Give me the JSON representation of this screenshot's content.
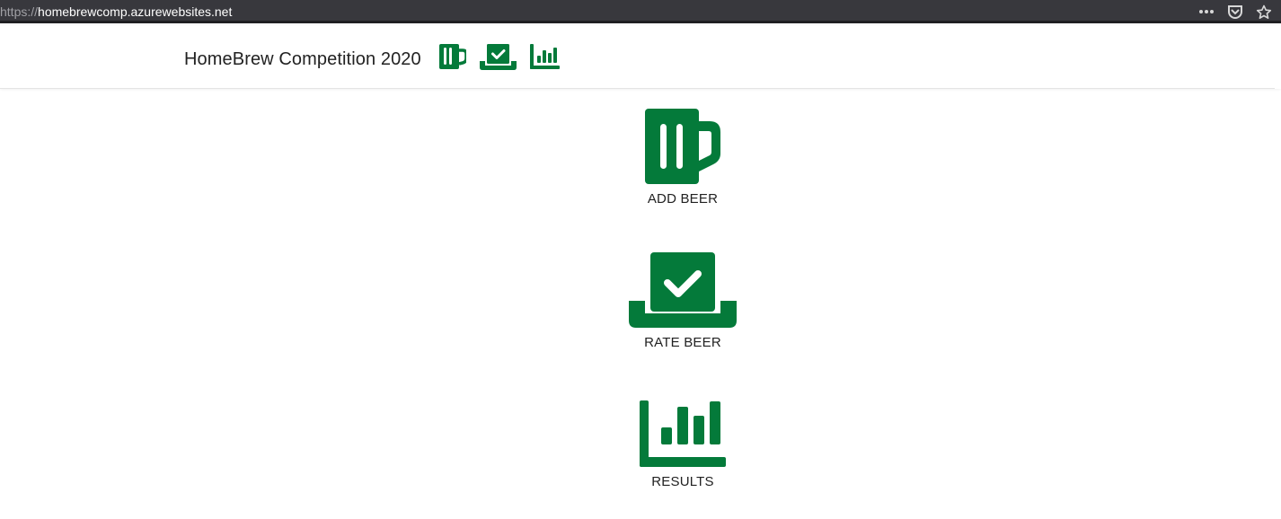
{
  "browser": {
    "url_scheme": "https://",
    "url_host": "homebrewcomp.azurewebsites.net"
  },
  "navbar": {
    "title": "HomeBrew Competition 2020",
    "icons": [
      "beer-mug-icon",
      "vote-box-icon",
      "bar-chart-icon"
    ]
  },
  "tiles": [
    {
      "label": "ADD BEER",
      "icon": "beer-mug-icon"
    },
    {
      "label": "RATE BEER",
      "icon": "vote-box-icon"
    },
    {
      "label": "RESULTS",
      "icon": "bar-chart-icon"
    }
  ],
  "colors": {
    "brand_green": "#047A3A",
    "text": "#222222",
    "browser_chrome": "#38383D"
  }
}
